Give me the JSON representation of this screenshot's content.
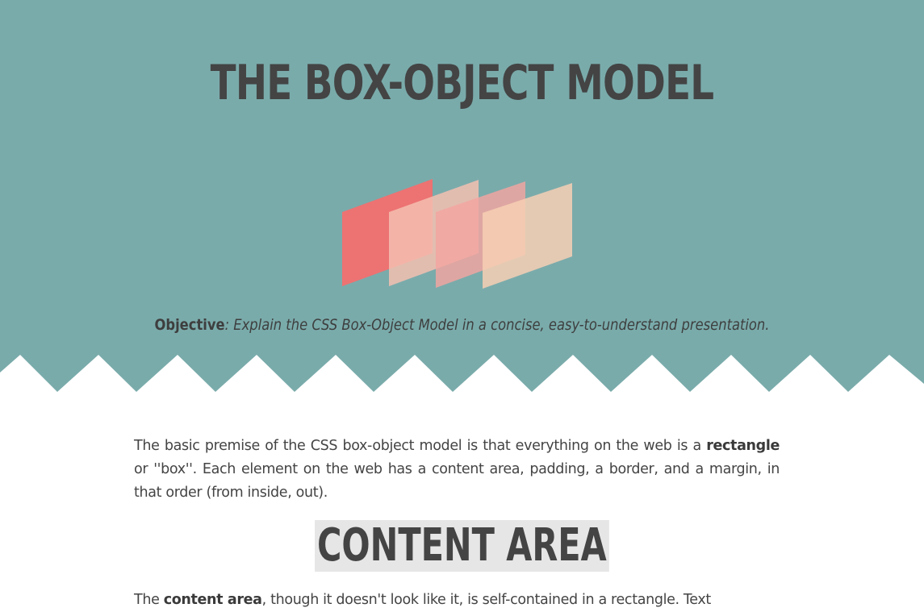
{
  "header": {
    "title": "THE BOX-OBJECT MODEL",
    "objective_label": "Objective",
    "objective_text": ": Explain the CSS Box-Object Model in a concise, easy-to-understand presentation."
  },
  "intro": {
    "part1": "The basic premise of the CSS box-object model is that everything on the web is a ",
    "bold": "rectangle",
    "part2": " or ''box''. Each element on the web has a content area, padding, a border, and a margin, in that order (from inside, out)."
  },
  "content_area": {
    "heading": "CONTENT AREA",
    "text_start": "The ",
    "bold": "content area",
    "text_rest": ", though it doesn't look like it, is self-contained in a rectangle. Text"
  },
  "colors": {
    "hero_bg": "#7aabab",
    "zigzag": "#ffffff",
    "text": "#444444",
    "heading_highlight": "#e6e6e6",
    "box_red": "#f07070",
    "box_peach": "#f3c0b0",
    "box_pink": "#f4a5a0",
    "box_cream": "#f7cfb4"
  },
  "icons": [
    "layered-boxes-illustration"
  ]
}
